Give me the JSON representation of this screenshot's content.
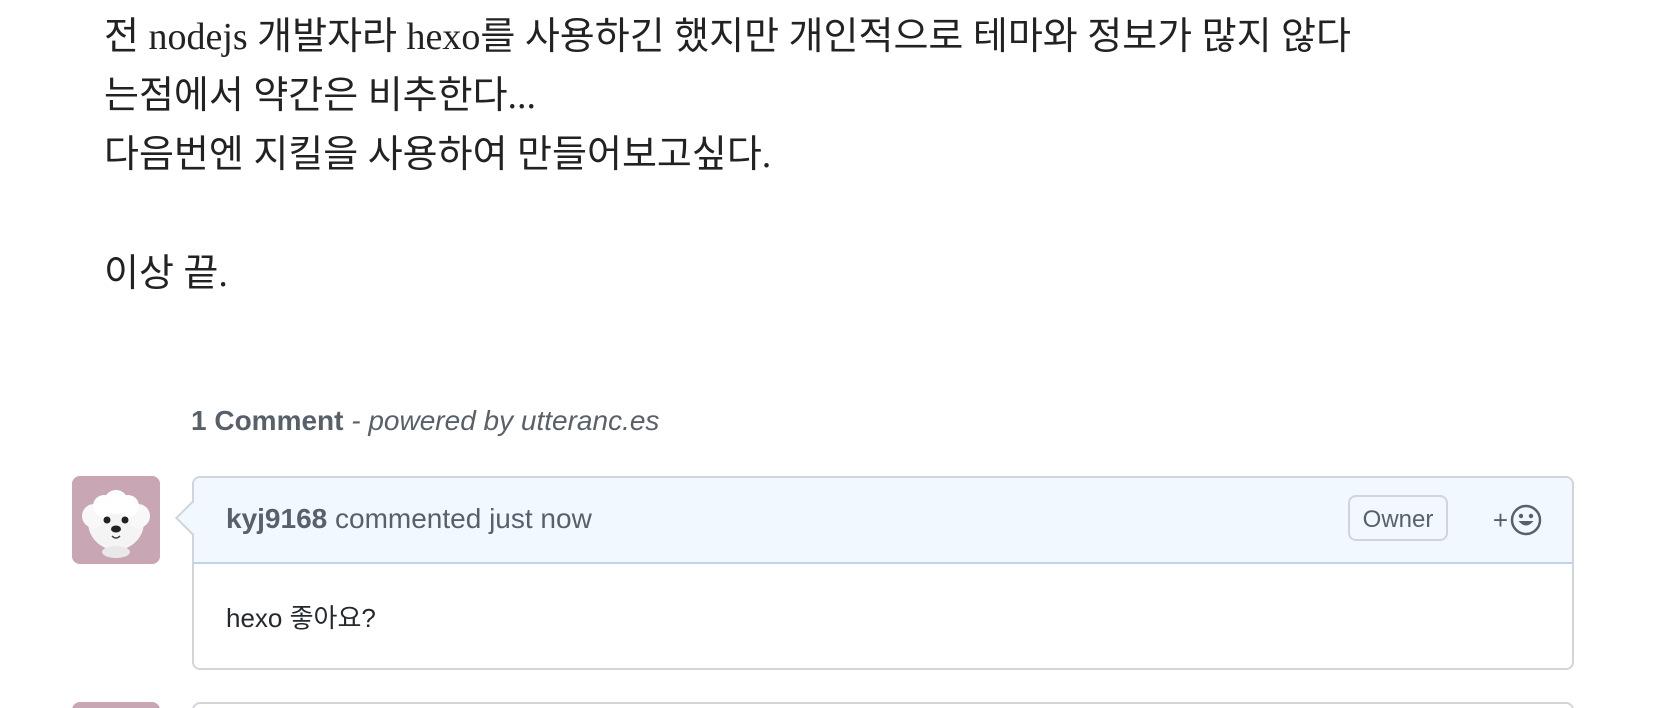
{
  "article": {
    "paragraph_1_line_1": "전 nodejs 개발자라 hexo를 사용하긴 했지만 개인적으로 테마와 정보가 많지 않다",
    "paragraph_1_line_2": "는점에서 약간은 비추한다...",
    "paragraph_2": "다음번엔 지킬을 사용하여 만들어보고싶다.",
    "closing": "이상 끝."
  },
  "comments_widget": {
    "count_label": "1 Comment",
    "powered_by": "- powered by utteranc.es",
    "comments": [
      {
        "author": "kyj9168",
        "action": "commented just now",
        "badge": "Owner",
        "reaction_plus": "+",
        "body": "hexo 좋아요?",
        "avatar_icon": "dog-avatar-icon"
      }
    ]
  },
  "colors": {
    "header_bg": "#f1f8ff",
    "border": "#d1d5da",
    "muted_text": "#586069",
    "avatar_bg": "#c9a6b4"
  }
}
